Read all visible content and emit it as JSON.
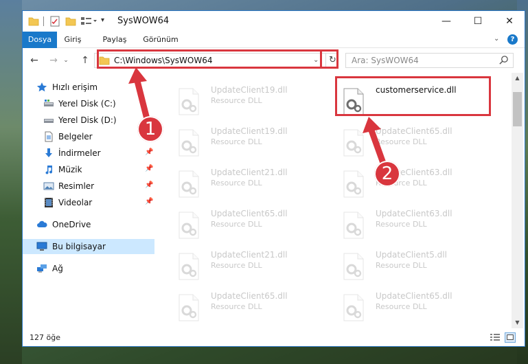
{
  "window": {
    "title": "SysWOW64",
    "buttons": {
      "minimize": "—",
      "maximize": "☐",
      "close": "✕"
    }
  },
  "ribbon": {
    "tabs": [
      "Dosya",
      "Giriş",
      "Paylaş",
      "Görünüm"
    ],
    "help": "?"
  },
  "address": {
    "path": "C:\\Windows\\SysWOW64",
    "search_placeholder": "Ara: SysWOW64"
  },
  "sidebar": {
    "items": [
      {
        "label": "Hızlı erişim",
        "icon": "star-icon"
      },
      {
        "label": "Yerel Disk (C:)",
        "icon": "drive-icon"
      },
      {
        "label": "Yerel Disk (D:)",
        "icon": "drive-icon"
      },
      {
        "label": "Belgeler",
        "icon": "documents-icon"
      },
      {
        "label": "İndirmeler",
        "icon": "download-icon"
      },
      {
        "label": "Müzik",
        "icon": "music-icon"
      },
      {
        "label": "Resimler",
        "icon": "pictures-icon"
      },
      {
        "label": "Videolar",
        "icon": "video-icon"
      },
      {
        "label": "OneDrive",
        "icon": "cloud-icon"
      },
      {
        "label": "Bu bilgisayar",
        "icon": "computer-icon"
      },
      {
        "label": "Ağ",
        "icon": "network-icon"
      }
    ]
  },
  "files": [
    {
      "name": "UpdateClient19.dll",
      "type": "Resource DLL",
      "faded": true
    },
    {
      "name": "customerservice.dll",
      "type": "",
      "faded": false
    },
    {
      "name": "UpdateClient19.dll",
      "type": "Resource DLL",
      "faded": true
    },
    {
      "name": "UpdateClient65.dll",
      "type": "Resource DLL",
      "faded": true
    },
    {
      "name": "UpdateClient21.dll",
      "type": "Resource DLL",
      "faded": true
    },
    {
      "name": "UpdateClient63.dll",
      "type": "Resource DLL",
      "faded": true
    },
    {
      "name": "UpdateClient65.dll",
      "type": "Resource DLL",
      "faded": true
    },
    {
      "name": "UpdateClient63.dll",
      "type": "Resource DLL",
      "faded": true
    },
    {
      "name": "UpdateClient21.dll",
      "type": "Resource DLL",
      "faded": true
    },
    {
      "name": "UpdateClient5.dll",
      "type": "Resource DLL",
      "faded": true
    },
    {
      "name": "UpdateClient65.dll",
      "type": "Resource DLL",
      "faded": true
    },
    {
      "name": "UpdateClient65.dll",
      "type": "Resource DLL",
      "faded": true
    }
  ],
  "status": {
    "item_count": "127 öğe"
  },
  "callouts": {
    "one": "1",
    "two": "2"
  },
  "colors": {
    "accent": "#1979ca",
    "highlight": "#d9363e",
    "selected": "#cce8ff"
  }
}
